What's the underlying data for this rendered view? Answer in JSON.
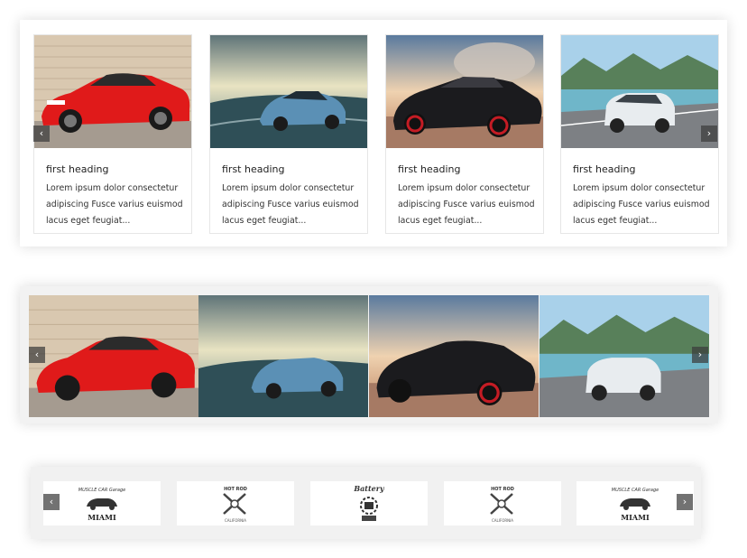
{
  "cards": [
    {
      "heading": "first heading",
      "text": "Lorem ipsum dolor consectetur adipiscing Fusce varius euismod lacus eget feugiat...",
      "image": "red-sports-car"
    },
    {
      "heading": "first heading",
      "text": "Lorem ipsum dolor consectetur adipiscing Fusce varius euismod lacus eget feugiat...",
      "image": "blue-coupe-road"
    },
    {
      "heading": "first heading",
      "text": "Lorem ipsum dolor consectetur adipiscing Fusce varius euismod lacus eget feugiat...",
      "image": "black-sports-car-sunset"
    },
    {
      "heading": "first heading",
      "text": "Lorem ipsum dolor consectetur adipiscing Fusce varius euismod lacus eget feugiat...",
      "image": "white-suv-lake"
    }
  ],
  "gallery": [
    "red-sports-car",
    "blue-coupe-road",
    "black-sports-car-sunset",
    "white-suv-lake"
  ],
  "logos": [
    {
      "top": "MUSCLE CAR Garage",
      "bottom": "MIAMI"
    },
    {
      "top": "HOT ROD",
      "bottom": "CALIFORNIA"
    },
    {
      "top": "Battery",
      "bottom": ""
    },
    {
      "top": "HOT ROD",
      "bottom": "CALIFORNIA"
    },
    {
      "top": "MUSCLE CAR Garage",
      "bottom": "MIAMI"
    }
  ],
  "nav": {
    "prev": "‹",
    "next": "›"
  },
  "colors": {
    "red_car": "#e01a1a",
    "blue_car": "#5b90b5",
    "black_car": "#1b1b1e",
    "white_suv": "#e8ecef",
    "nav_bg": "#3c3c3c"
  }
}
